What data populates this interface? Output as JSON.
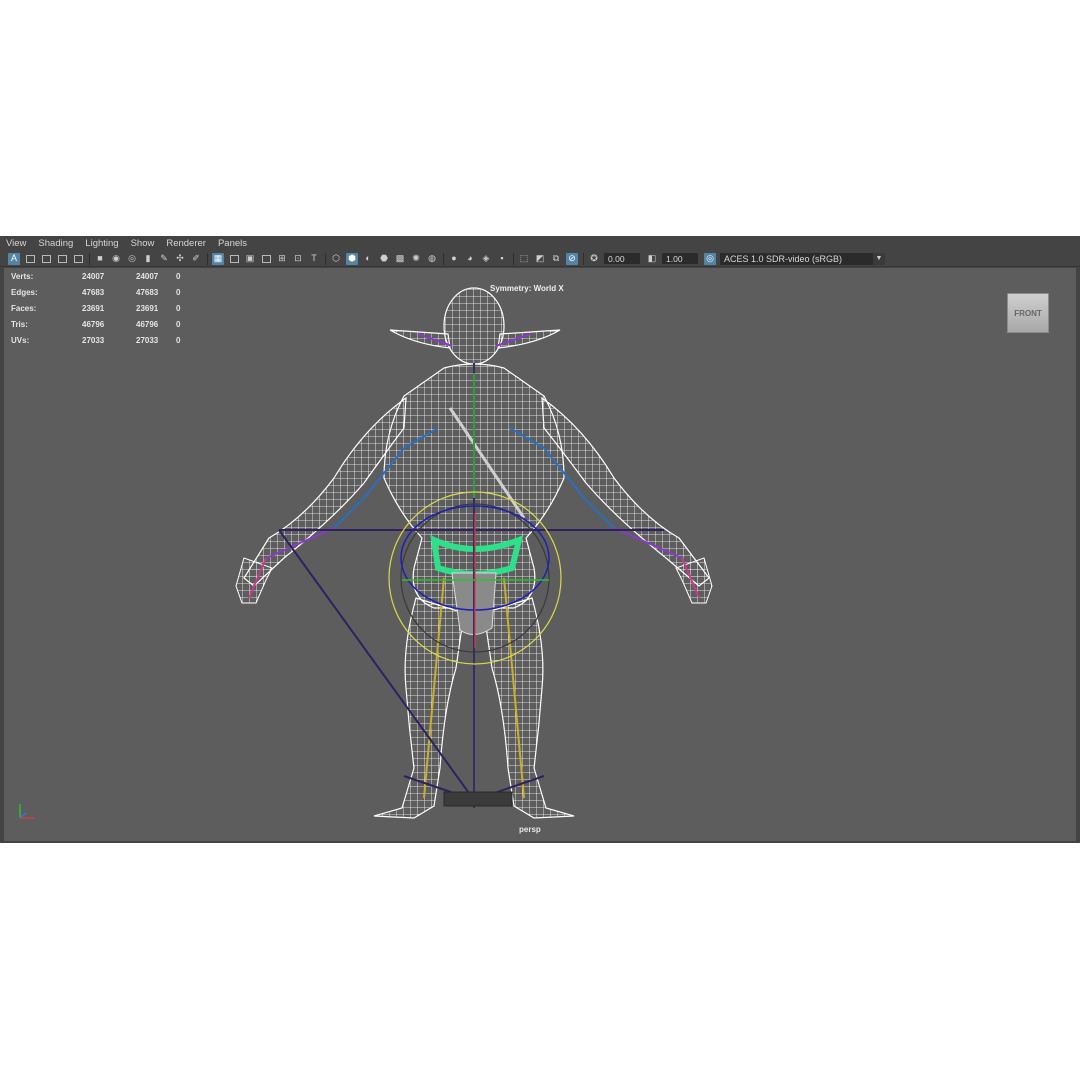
{
  "menu": [
    "View",
    "Shading",
    "Lighting",
    "Show",
    "Renderer",
    "Panels"
  ],
  "toolbar": {
    "exposure": "0.00",
    "gamma": "1.00",
    "color_space": "ACES 1.0 SDR-video (sRGB)"
  },
  "hud": {
    "rows": [
      {
        "label": "Verts:",
        "v1": "24007",
        "v2": "24007",
        "v3": "0"
      },
      {
        "label": "Edges:",
        "v1": "47683",
        "v2": "47683",
        "v3": "0"
      },
      {
        "label": "Faces:",
        "v1": "23691",
        "v2": "23691",
        "v3": "0"
      },
      {
        "label": "Tris:",
        "v1": "46796",
        "v2": "46796",
        "v3": "0"
      },
      {
        "label": "UVs:",
        "v1": "27033",
        "v2": "27033",
        "v3": "0"
      }
    ]
  },
  "symmetry": "Symmetry: World X",
  "viewcube": "FRONT",
  "camera": "persp",
  "colors": {
    "viewport_bg": "#5d5d5d",
    "wire": "#ffffff",
    "joint_purple": "#3a2a66",
    "control_yellow": "#d8d84a",
    "control_blue": "#1f1fb8",
    "loincloth_green": "#2ee08a"
  }
}
